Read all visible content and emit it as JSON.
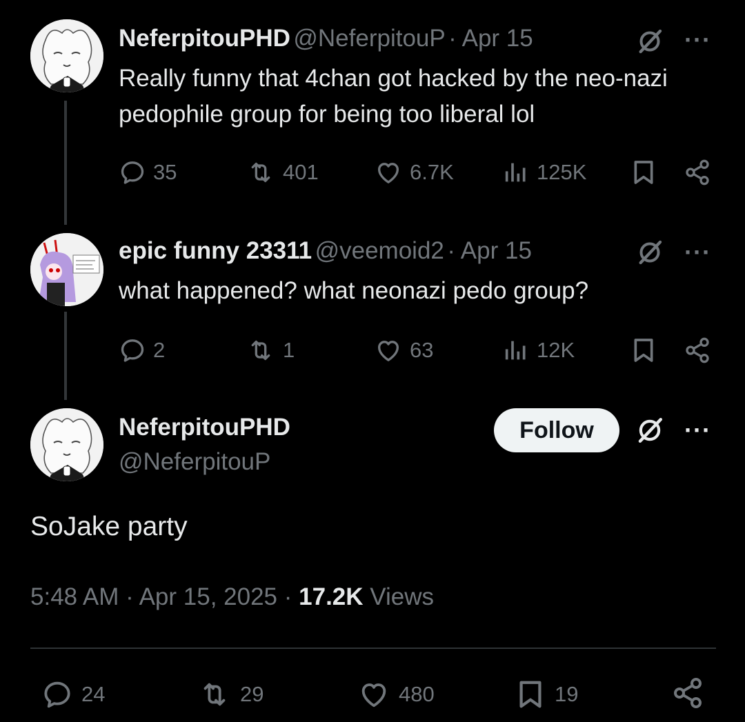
{
  "tweets": [
    {
      "name": "NeferpitouPHD",
      "handle": "@NeferpitouP",
      "date": "· Apr 15",
      "text": "Really funny that 4chan got hacked by the neo-nazi pedophile group for being too liberal lol",
      "replies": "35",
      "reposts": "401",
      "likes": "6.7K",
      "views": "125K"
    },
    {
      "name": "epic funny 23311",
      "handle": "@veemoid2",
      "date": "· Apr 15",
      "text": "what happened? what neonazi pedo group?",
      "replies": "2",
      "reposts": "1",
      "likes": "63",
      "views": "12K"
    }
  ],
  "main_tweet": {
    "name": "NeferpitouPHD",
    "handle": "@NeferpitouP",
    "follow_label": "Follow",
    "text": "SoJake party",
    "timestamp": "5:48 AM · Apr 15, 2025 ·",
    "views_count": "17.2K",
    "views_label": "Views",
    "replies": "24",
    "reposts": "29",
    "likes": "480",
    "bookmarks": "19"
  },
  "icons": [
    "reply-icon",
    "repost-icon",
    "like-icon",
    "views-icon",
    "bookmark-icon",
    "share-icon",
    "grok-icon",
    "more-icon"
  ],
  "colors": {
    "background": "#000000",
    "text": "#e7e9ea",
    "muted": "#71767b",
    "follow_bg": "#eff3f4"
  }
}
